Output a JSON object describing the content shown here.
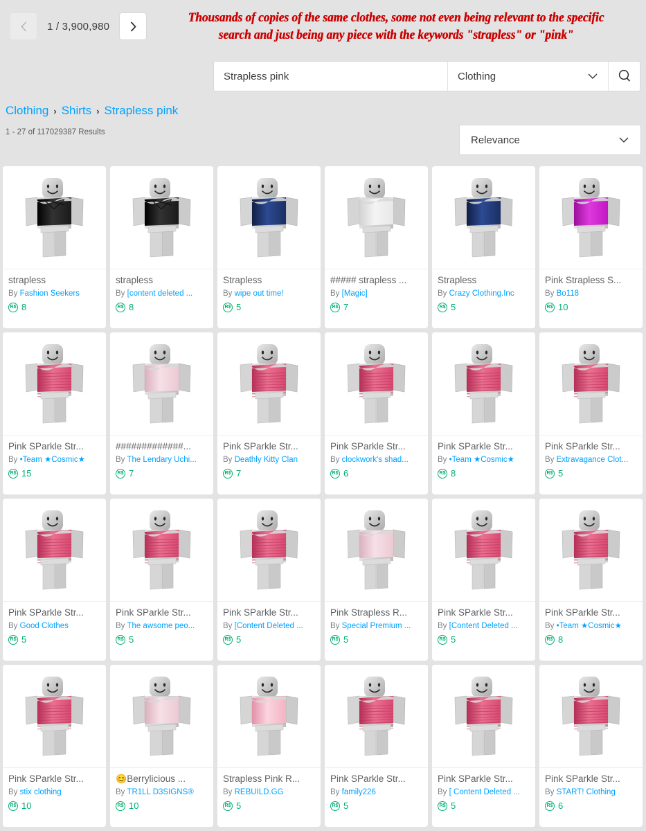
{
  "pager": {
    "current": "1",
    "separator": "/",
    "total": "3,900,980",
    "prev_icon": "chevron-left-icon",
    "next_icon": "chevron-right-icon"
  },
  "annotation": {
    "line1": "Thousands of copies of the same clothes, some not even being relevant to the specific",
    "line2": "search and just being any piece with the keywords \"strapless\" or \"pink\"",
    "color": "#cc0000"
  },
  "search": {
    "value": "Strapless pink",
    "placeholder": "Search",
    "category": "Clothing",
    "chevron_icon": "chevron-down-icon",
    "search_icon": "search-icon"
  },
  "breadcrumb": {
    "items": [
      "Clothing",
      "Shirts",
      "Strapless pink"
    ],
    "separator": "›"
  },
  "results": {
    "count_text": "1 - 27 of 117029387 Results"
  },
  "sort": {
    "label": "Relevance",
    "chevron_icon": "chevron-down-icon"
  },
  "colors": {
    "link": "#00a2ff",
    "robux_green": "#00b06f",
    "page_bg": "#e3e3e3",
    "card_bg": "#ffffff"
  },
  "items": [
    {
      "title": "strapless",
      "by_prefix": "By ",
      "creator": "Fashion Seekers",
      "price": "8",
      "shirt": "black-strappy",
      "emoji": ""
    },
    {
      "title": "strapless",
      "by_prefix": "By ",
      "creator": "[content deleted ...",
      "price": "8",
      "shirt": "black-strappy",
      "emoji": ""
    },
    {
      "title": "Strapless",
      "by_prefix": "By ",
      "creator": "wipe out time!",
      "price": "5",
      "shirt": "navy-band",
      "emoji": ""
    },
    {
      "title": "##### strapless ...",
      "by_prefix": "By ",
      "creator": "[Magic]",
      "price": "7",
      "shirt": "white-band",
      "emoji": ""
    },
    {
      "title": "Strapless",
      "by_prefix": "By ",
      "creator": "Crazy Clothing.Inc",
      "price": "5",
      "shirt": "navy-band",
      "emoji": ""
    },
    {
      "title": "Pink Strapless S...",
      "by_prefix": "By ",
      "creator": "Bo118",
      "price": "10",
      "shirt": "magenta-band",
      "emoji": ""
    },
    {
      "title": "Pink SParkle Str...",
      "by_prefix": "By ",
      "creator": "•Team ★Cosmic★",
      "price": "15",
      "shirt": "pink-sparkle",
      "emoji": ""
    },
    {
      "title": "#############...",
      "by_prefix": "By ",
      "creator": "The Lendary Uchi...",
      "price": "7",
      "shirt": "pale-pink",
      "emoji": ""
    },
    {
      "title": "Pink SParkle Str...",
      "by_prefix": "By ",
      "creator": "Deathly Kitty Clan",
      "price": "7",
      "shirt": "pink-sparkle",
      "emoji": ""
    },
    {
      "title": "Pink SParkle Str...",
      "by_prefix": "By ",
      "creator": "clockwork's shad...",
      "price": "6",
      "shirt": "pink-sparkle",
      "emoji": ""
    },
    {
      "title": "Pink SParkle Str...",
      "by_prefix": "By ",
      "creator": "•Team ★Cosmic★",
      "price": "8",
      "shirt": "pink-sparkle",
      "emoji": ""
    },
    {
      "title": "Pink SParkle Str...",
      "by_prefix": "By ",
      "creator": "Extravagance Clot...",
      "price": "5",
      "shirt": "pink-sparkle",
      "emoji": ""
    },
    {
      "title": "Pink SParkle Str...",
      "by_prefix": "By ",
      "creator": "Good Clothes",
      "price": "5",
      "shirt": "pink-sparkle",
      "emoji": ""
    },
    {
      "title": "Pink SParkle Str...",
      "by_prefix": "By ",
      "creator": "The awsome peo...",
      "price": "5",
      "shirt": "pink-sparkle",
      "emoji": ""
    },
    {
      "title": "Pink SParkle Str...",
      "by_prefix": "By ",
      "creator": "[Content Deleted ...",
      "price": "5",
      "shirt": "pink-sparkle",
      "emoji": ""
    },
    {
      "title": "Pink Strapless R...",
      "by_prefix": "By ",
      "creator": "Special Premium ...",
      "price": "5",
      "shirt": "pale-pink",
      "emoji": ""
    },
    {
      "title": "Pink SParkle Str...",
      "by_prefix": "By ",
      "creator": "[Content Deleted ...",
      "price": "5",
      "shirt": "pink-sparkle",
      "emoji": ""
    },
    {
      "title": "Pink SParkle Str...",
      "by_prefix": "By ",
      "creator": "•Team ★Cosmic★",
      "price": "8",
      "shirt": "pink-sparkle",
      "emoji": ""
    },
    {
      "title": "Pink SParkle Str...",
      "by_prefix": "By ",
      "creator": "stix clothing",
      "price": "10",
      "shirt": "pink-sparkle",
      "emoji": ""
    },
    {
      "title": "Berrylicious ...",
      "by_prefix": "By ",
      "creator": "TR1LL D3SIGNS®",
      "price": "10",
      "shirt": "pale-pink",
      "emoji": "😊"
    },
    {
      "title": "Strapless Pink R...",
      "by_prefix": "By ",
      "creator": "REBUILD.GG",
      "price": "5",
      "shirt": "soft-pink",
      "emoji": ""
    },
    {
      "title": "Pink SParkle Str...",
      "by_prefix": "By ",
      "creator": "family226",
      "price": "5",
      "shirt": "pink-sparkle",
      "emoji": ""
    },
    {
      "title": "Pink SParkle Str...",
      "by_prefix": "By ",
      "creator": "[ Content Deleted ...",
      "price": "5",
      "shirt": "pink-sparkle",
      "emoji": ""
    },
    {
      "title": "Pink SParkle Str...",
      "by_prefix": "By ",
      "creator": "START! Clothing",
      "price": "6",
      "shirt": "pink-sparkle",
      "emoji": ""
    }
  ]
}
